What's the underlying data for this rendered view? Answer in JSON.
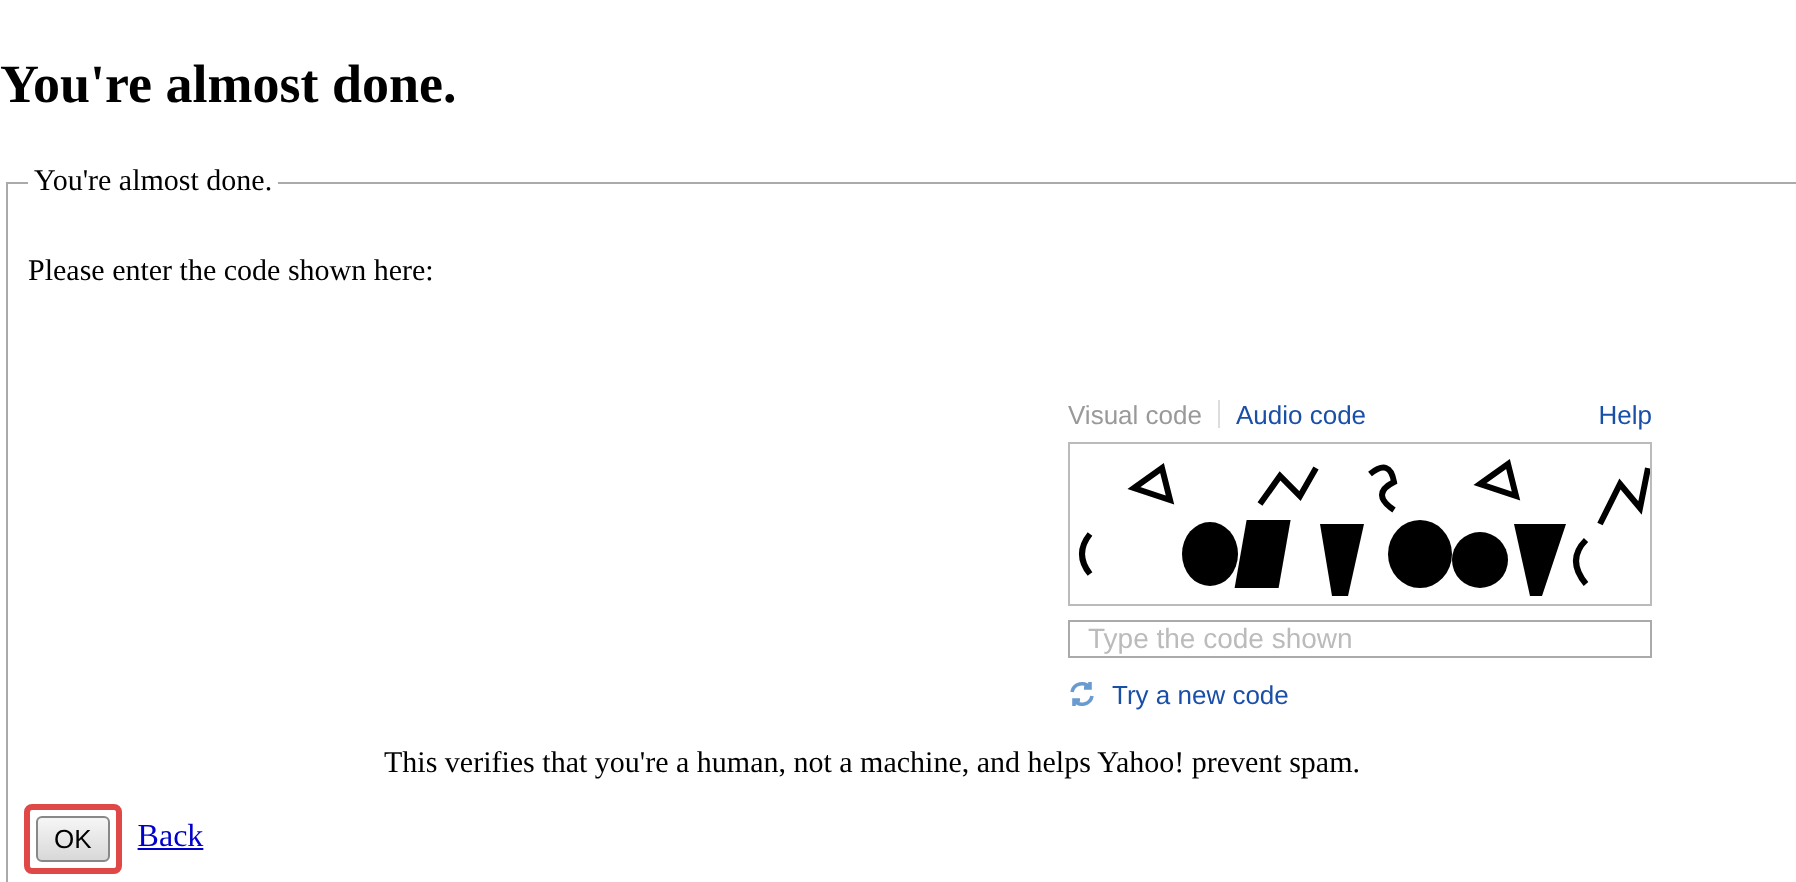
{
  "heading": "You're almost done.",
  "fieldset": {
    "legend": "You're almost done.",
    "prompt": "Please enter the code shown here:",
    "captcha": {
      "tabs": [
        {
          "label": "Visual code",
          "selected": true
        },
        {
          "label": "Audio code",
          "selected": false
        }
      ],
      "help": "Help",
      "input": {
        "placeholder": "Type the code shown"
      },
      "refresh": "Try a new code"
    },
    "note": "This verifies that you're a human, not a machine, and helps Yahoo! prevent spam.",
    "ok_button": {
      "label": "OK",
      "highlighted": true
    },
    "back_link": "Back"
  }
}
